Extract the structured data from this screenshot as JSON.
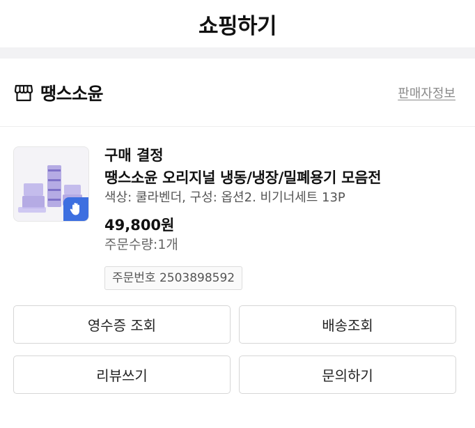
{
  "header": {
    "title": "쇼핑하기"
  },
  "store": {
    "name": "땡스소윤",
    "seller_info_label": "판매자정보",
    "icon": "store-icon"
  },
  "order": {
    "status": "구매 결정",
    "product_name": "땡스소윤 오리지널 냉동/냉장/밀폐용기 모음전",
    "option": "색상: 쿨라벤더, 구성: 옵션2. 비기너세트 13P",
    "price": "49,800원",
    "quantity": "주문수량:1개",
    "order_number": "주문번호 2503898592",
    "badge_icon": "hand-icon"
  },
  "actions": {
    "receipt": "영수증 조회",
    "delivery": "배송조회",
    "review": "리뷰쓰기",
    "inquiry": "문의하기"
  },
  "colors": {
    "badge": "#3d6fe0",
    "divider": "#f2f2f4",
    "product_purple": "#9b8fd6"
  }
}
